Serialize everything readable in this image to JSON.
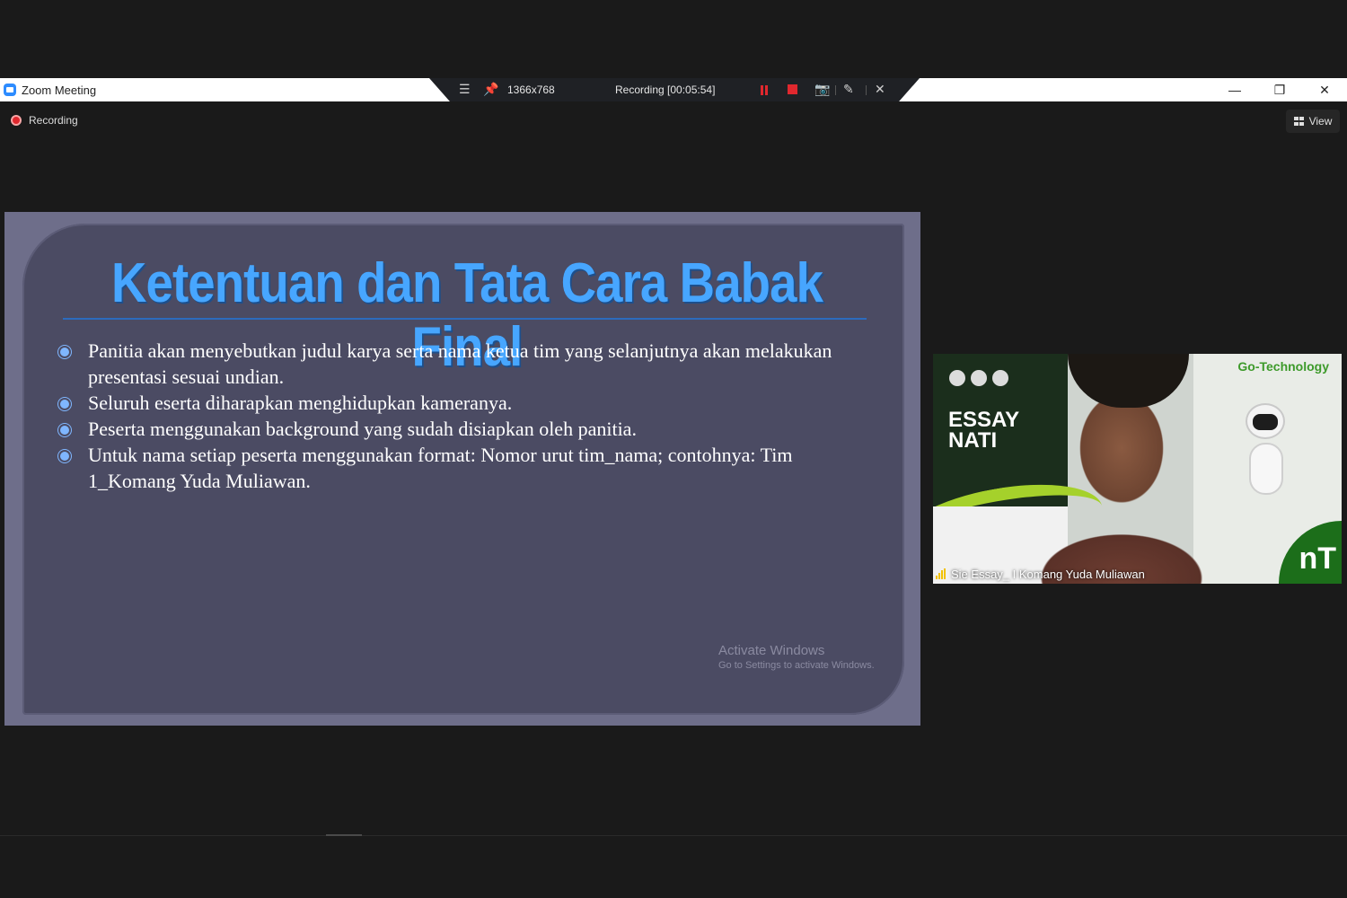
{
  "window": {
    "title": "Zoom Meeting",
    "controls": [
      "minimize",
      "restore",
      "close"
    ]
  },
  "recording_toolbar": {
    "resolution": "1366x768",
    "status": "Recording [00:05:54]",
    "icons": [
      "menu-icon",
      "pin-icon",
      "pause-icon",
      "stop-icon",
      "camera-icon",
      "pen-icon",
      "close-icon"
    ],
    "accent_color": "#e0282e"
  },
  "meeting": {
    "recording_label": "Recording",
    "view_label": "View"
  },
  "slide": {
    "title": "Ketentuan dan Tata Cara Babak Final",
    "bullets": [
      "Panitia akan menyebutkan judul karya serta nama ketua tim yang selanjutnya akan melakukan presentasi sesuai undian.",
      "Seluruh eserta diharapkan menghidupkan kameranya.",
      "Peserta menggunakan background yang sudah disiapkan oleh panitia.",
      "Untuk nama setiap peserta menggunakan format: Nomor urut tim_nama; contohnya: Tim 1_Komang Yuda Muliawan."
    ],
    "watermark_line1": "Activate Windows",
    "watermark_line2": "Go to Settings to activate Windows."
  },
  "video_tile": {
    "participant_name": "Sie Essay_ I Komang Yuda Muliawan",
    "background_brand": "Go-Technology",
    "background_text": "ESSAY\nNATI"
  }
}
